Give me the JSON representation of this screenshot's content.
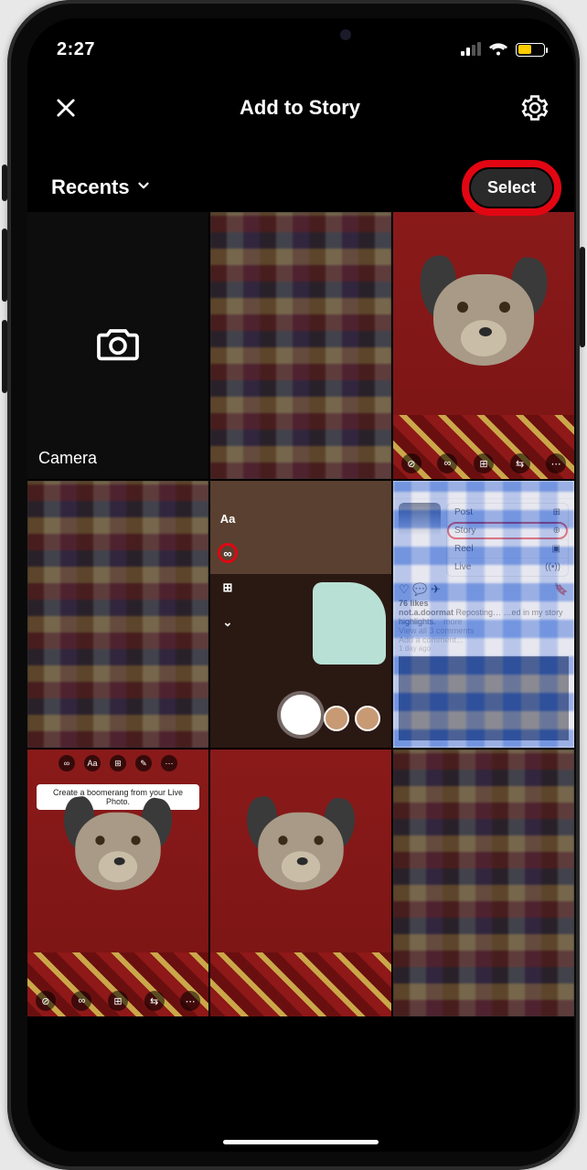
{
  "status": {
    "time": "2:27",
    "signal_bars": 2,
    "wifi": true,
    "battery_low_power": true
  },
  "header": {
    "title": "Add to Story"
  },
  "album": {
    "label": "Recents",
    "select_label": "Select"
  },
  "highlight": {
    "target": "select-button",
    "color": "#e20613"
  },
  "grid": {
    "camera_label": "Camera",
    "tiles": [
      {
        "kind": "camera"
      },
      {
        "kind": "pixelated"
      },
      {
        "kind": "dog",
        "icons": [
          "⊘",
          "∞",
          "⊞",
          "⇆",
          "⋯"
        ]
      },
      {
        "kind": "pixelated"
      },
      {
        "kind": "story-editor",
        "side_items": [
          "Aa",
          "∞",
          "⊞",
          "⌄"
        ],
        "ringed_item": "∞"
      },
      {
        "kind": "post-menu",
        "menu": [
          {
            "label": "Post",
            "glyph": "⊞"
          },
          {
            "label": "Story",
            "glyph": "⊕",
            "ringed": true
          },
          {
            "label": "Reel",
            "glyph": "▣"
          },
          {
            "label": "Live",
            "glyph": "((•))"
          }
        ],
        "likes": "76 likes",
        "username": "not.a.doormat",
        "caption": "Reposting… …ed in my story highlights.",
        "more": "more",
        "view_comments": "View all 3 comments",
        "add_comment": "Add a comment...",
        "age": "1 day ago"
      },
      {
        "kind": "dog-small",
        "top_icons": [
          "∞",
          "Aa",
          "⊞",
          "✎",
          "⋯"
        ],
        "tooltip": "Create a boomerang from your Live Photo."
      },
      {
        "kind": "dog-small"
      },
      {
        "kind": "pixelated"
      }
    ]
  }
}
